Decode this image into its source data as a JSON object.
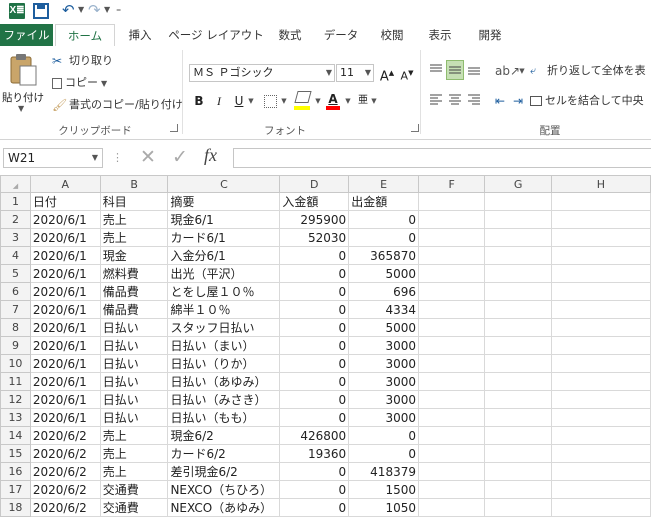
{
  "quick_access": {
    "logo_text": "X≣",
    "undo_glyph": "↶",
    "redo_glyph": "↷",
    "customize_glyph": "₌"
  },
  "tabs": [
    {
      "label": "ファイル"
    },
    {
      "label": "ホーム"
    },
    {
      "label": "挿入"
    },
    {
      "label": "ページ レイアウト"
    },
    {
      "label": "数式"
    },
    {
      "label": "データ"
    },
    {
      "label": "校閲"
    },
    {
      "label": "表示"
    },
    {
      "label": "開発"
    }
  ],
  "ribbon": {
    "clipboard": {
      "paste": "貼り付け",
      "cut": "切り取り",
      "copy": "コピー",
      "format_painter": "書式のコピー/貼り付け",
      "group_label": "クリップボード"
    },
    "font": {
      "font_name": "ＭＳ Ｐゴシック",
      "font_size": "11",
      "grow": "A",
      "shrink": "A",
      "bold": "B",
      "italic": "I",
      "underline": "U",
      "font_color_glyph": "A",
      "phonetic_glyph": "亜",
      "group_label": "フォント"
    },
    "alignment": {
      "wrap_text": "折り返して全体を表",
      "merge_center": "セルを結合して中央",
      "group_label": "配置"
    }
  },
  "formula_bar": {
    "name_box": "W21",
    "cancel_glyph": "✕",
    "enter_glyph": "✓",
    "fx_label": "fx",
    "content": ""
  },
  "sheet": {
    "columns": [
      "A",
      "B",
      "C",
      "D",
      "E",
      "F",
      "G",
      "H"
    ],
    "rows": [
      {
        "n": "1",
        "a": "日付",
        "b": "科目",
        "c": "摘要",
        "d": "入金額",
        "e": "出金額"
      },
      {
        "n": "2",
        "a": "2020/6/1",
        "b": "売上",
        "c": "現金6/1",
        "d": "295900",
        "e": "0"
      },
      {
        "n": "3",
        "a": "2020/6/1",
        "b": "売上",
        "c": "カード6/1",
        "d": "52030",
        "e": "0"
      },
      {
        "n": "4",
        "a": "2020/6/1",
        "b": "現金",
        "c": "入金分6/1",
        "d": "0",
        "e": "365870"
      },
      {
        "n": "5",
        "a": "2020/6/1",
        "b": "燃料費",
        "c": "出光（平沢）",
        "d": "0",
        "e": "5000"
      },
      {
        "n": "6",
        "a": "2020/6/1",
        "b": "備品費",
        "c": "とをし屋１０％",
        "d": "0",
        "e": "696"
      },
      {
        "n": "7",
        "a": "2020/6/1",
        "b": "備品費",
        "c": "綿半１０％",
        "d": "0",
        "e": "4334"
      },
      {
        "n": "8",
        "a": "2020/6/1",
        "b": "日払い",
        "c": "スタッフ日払い",
        "d": "0",
        "e": "5000"
      },
      {
        "n": "9",
        "a": "2020/6/1",
        "b": "日払い",
        "c": "日払い（まい）",
        "d": "0",
        "e": "3000"
      },
      {
        "n": "10",
        "a": "2020/6/1",
        "b": "日払い",
        "c": "日払い（りか）",
        "d": "0",
        "e": "3000"
      },
      {
        "n": "11",
        "a": "2020/6/1",
        "b": "日払い",
        "c": "日払い（あゆみ）",
        "d": "0",
        "e": "3000"
      },
      {
        "n": "12",
        "a": "2020/6/1",
        "b": "日払い",
        "c": "日払い（みさき）",
        "d": "0",
        "e": "3000"
      },
      {
        "n": "13",
        "a": "2020/6/1",
        "b": "日払い",
        "c": "日払い（もも）",
        "d": "0",
        "e": "3000"
      },
      {
        "n": "14",
        "a": "2020/6/2",
        "b": "売上",
        "c": "現金6/2",
        "d": "426800",
        "e": "0"
      },
      {
        "n": "15",
        "a": "2020/6/2",
        "b": "売上",
        "c": "カード6/2",
        "d": "19360",
        "e": "0"
      },
      {
        "n": "16",
        "a": "2020/6/2",
        "b": "売上",
        "c": "差引現金6/2",
        "d": "0",
        "e": "418379"
      },
      {
        "n": "17",
        "a": "2020/6/2",
        "b": "交通費",
        "c": "NEXCO（ちひろ）",
        "d": "0",
        "e": "1500"
      },
      {
        "n": "18",
        "a": "2020/6/2",
        "b": "交通費",
        "c": "NEXCO（あゆみ）",
        "d": "0",
        "e": "1050"
      }
    ]
  },
  "colors": {
    "excel_green": "#217346",
    "ribbon_border": "#d4d4d4",
    "header_bg": "#f3f3f3"
  }
}
